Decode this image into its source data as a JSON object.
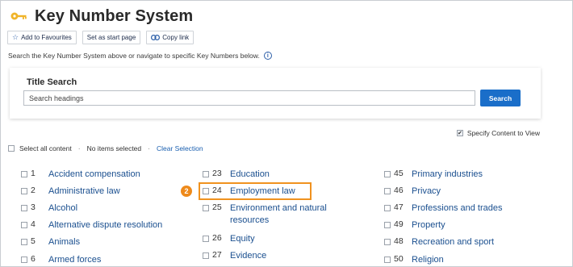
{
  "header": {
    "title": "Key Number System",
    "icon": "key-icon"
  },
  "toolbar": {
    "add_favourites": "Add to Favourites",
    "set_start_page": "Set as start page",
    "copy_link": "Copy link"
  },
  "hint": "Search the Key Number System above or navigate to specific Key Numbers below.",
  "search": {
    "title": "Title Search",
    "value": "Search headings",
    "button": "Search"
  },
  "specify_content": {
    "label": "Specify Content to View",
    "checked": true
  },
  "selection": {
    "select_all": "Select all content",
    "items_selected": "No items selected",
    "clear": "Clear Selection"
  },
  "columns": [
    [
      {
        "num": "1",
        "label": "Accident compensation"
      },
      {
        "num": "2",
        "label": "Administrative law"
      },
      {
        "num": "3",
        "label": "Alcohol"
      },
      {
        "num": "4",
        "label": "Alternative dispute resolution"
      },
      {
        "num": "5",
        "label": "Animals"
      },
      {
        "num": "6",
        "label": "Armed forces"
      }
    ],
    [
      {
        "num": "23",
        "label": "Education"
      },
      {
        "num": "24",
        "label": "Employment law"
      },
      {
        "num": "25",
        "label": "Environment and natural resources"
      },
      {
        "num": "26",
        "label": "Equity"
      },
      {
        "num": "27",
        "label": "Evidence"
      }
    ],
    [
      {
        "num": "45",
        "label": "Primary industries"
      },
      {
        "num": "46",
        "label": "Privacy"
      },
      {
        "num": "47",
        "label": "Professions and trades"
      },
      {
        "num": "49",
        "label": "Property"
      },
      {
        "num": "48",
        "label": "Recreation and sport"
      },
      {
        "num": "50",
        "label": "Religion"
      }
    ]
  ],
  "annotation": {
    "badge": "2",
    "color": "#ee8a1b"
  }
}
